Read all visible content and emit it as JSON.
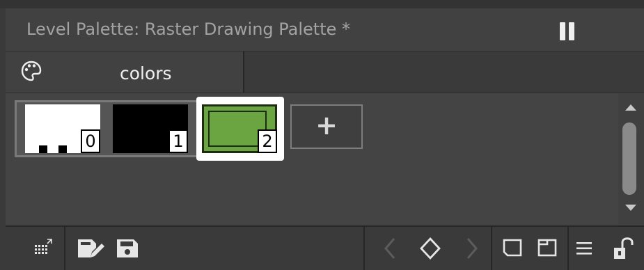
{
  "titlebar": {
    "title": "Level Palette: Raster Drawing Palette *",
    "pause_icon": "pause-icon"
  },
  "tab": {
    "icon": "palette-icon",
    "label": "colors"
  },
  "chips": [
    {
      "index": "0",
      "color": "#ffffff"
    },
    {
      "index": "1",
      "color": "#000000"
    },
    {
      "index": "2",
      "color": "#6aa542",
      "selected": true
    }
  ],
  "add_button": {
    "label": "+"
  },
  "toolbar": {
    "icons": [
      "grid-view-icon",
      "edit-palette-icon",
      "save-icon",
      "previous-icon",
      "keyframe-icon",
      "next-icon",
      "new-page-icon",
      "new-style-icon",
      "menu-icon",
      "lock-icon"
    ]
  },
  "colors": {
    "background": "#3c3c3c",
    "accent": "#6aa542"
  }
}
